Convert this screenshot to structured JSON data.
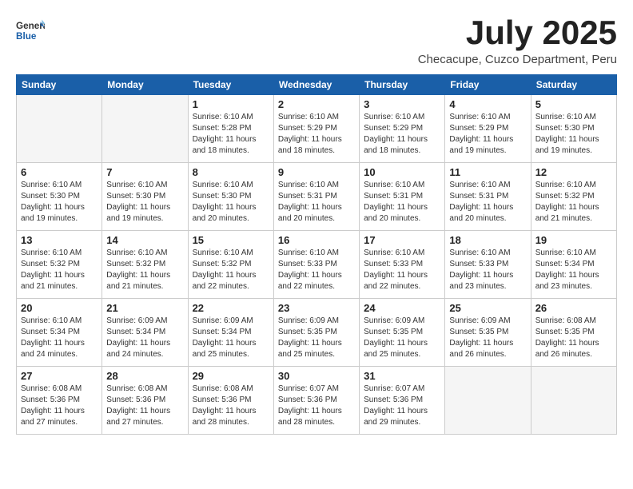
{
  "header": {
    "logo_general": "General",
    "logo_blue": "Blue",
    "month": "July 2025",
    "location": "Checacupe, Cuzco Department, Peru"
  },
  "weekdays": [
    "Sunday",
    "Monday",
    "Tuesday",
    "Wednesday",
    "Thursday",
    "Friday",
    "Saturday"
  ],
  "weeks": [
    [
      {
        "day": "",
        "sunrise": "",
        "sunset": "",
        "daylight": ""
      },
      {
        "day": "",
        "sunrise": "",
        "sunset": "",
        "daylight": ""
      },
      {
        "day": "1",
        "sunrise": "Sunrise: 6:10 AM",
        "sunset": "Sunset: 5:28 PM",
        "daylight": "Daylight: 11 hours and 18 minutes."
      },
      {
        "day": "2",
        "sunrise": "Sunrise: 6:10 AM",
        "sunset": "Sunset: 5:29 PM",
        "daylight": "Daylight: 11 hours and 18 minutes."
      },
      {
        "day": "3",
        "sunrise": "Sunrise: 6:10 AM",
        "sunset": "Sunset: 5:29 PM",
        "daylight": "Daylight: 11 hours and 18 minutes."
      },
      {
        "day": "4",
        "sunrise": "Sunrise: 6:10 AM",
        "sunset": "Sunset: 5:29 PM",
        "daylight": "Daylight: 11 hours and 19 minutes."
      },
      {
        "day": "5",
        "sunrise": "Sunrise: 6:10 AM",
        "sunset": "Sunset: 5:30 PM",
        "daylight": "Daylight: 11 hours and 19 minutes."
      }
    ],
    [
      {
        "day": "6",
        "sunrise": "Sunrise: 6:10 AM",
        "sunset": "Sunset: 5:30 PM",
        "daylight": "Daylight: 11 hours and 19 minutes."
      },
      {
        "day": "7",
        "sunrise": "Sunrise: 6:10 AM",
        "sunset": "Sunset: 5:30 PM",
        "daylight": "Daylight: 11 hours and 19 minutes."
      },
      {
        "day": "8",
        "sunrise": "Sunrise: 6:10 AM",
        "sunset": "Sunset: 5:30 PM",
        "daylight": "Daylight: 11 hours and 20 minutes."
      },
      {
        "day": "9",
        "sunrise": "Sunrise: 6:10 AM",
        "sunset": "Sunset: 5:31 PM",
        "daylight": "Daylight: 11 hours and 20 minutes."
      },
      {
        "day": "10",
        "sunrise": "Sunrise: 6:10 AM",
        "sunset": "Sunset: 5:31 PM",
        "daylight": "Daylight: 11 hours and 20 minutes."
      },
      {
        "day": "11",
        "sunrise": "Sunrise: 6:10 AM",
        "sunset": "Sunset: 5:31 PM",
        "daylight": "Daylight: 11 hours and 20 minutes."
      },
      {
        "day": "12",
        "sunrise": "Sunrise: 6:10 AM",
        "sunset": "Sunset: 5:32 PM",
        "daylight": "Daylight: 11 hours and 21 minutes."
      }
    ],
    [
      {
        "day": "13",
        "sunrise": "Sunrise: 6:10 AM",
        "sunset": "Sunset: 5:32 PM",
        "daylight": "Daylight: 11 hours and 21 minutes."
      },
      {
        "day": "14",
        "sunrise": "Sunrise: 6:10 AM",
        "sunset": "Sunset: 5:32 PM",
        "daylight": "Daylight: 11 hours and 21 minutes."
      },
      {
        "day": "15",
        "sunrise": "Sunrise: 6:10 AM",
        "sunset": "Sunset: 5:32 PM",
        "daylight": "Daylight: 11 hours and 22 minutes."
      },
      {
        "day": "16",
        "sunrise": "Sunrise: 6:10 AM",
        "sunset": "Sunset: 5:33 PM",
        "daylight": "Daylight: 11 hours and 22 minutes."
      },
      {
        "day": "17",
        "sunrise": "Sunrise: 6:10 AM",
        "sunset": "Sunset: 5:33 PM",
        "daylight": "Daylight: 11 hours and 22 minutes."
      },
      {
        "day": "18",
        "sunrise": "Sunrise: 6:10 AM",
        "sunset": "Sunset: 5:33 PM",
        "daylight": "Daylight: 11 hours and 23 minutes."
      },
      {
        "day": "19",
        "sunrise": "Sunrise: 6:10 AM",
        "sunset": "Sunset: 5:34 PM",
        "daylight": "Daylight: 11 hours and 23 minutes."
      }
    ],
    [
      {
        "day": "20",
        "sunrise": "Sunrise: 6:10 AM",
        "sunset": "Sunset: 5:34 PM",
        "daylight": "Daylight: 11 hours and 24 minutes."
      },
      {
        "day": "21",
        "sunrise": "Sunrise: 6:09 AM",
        "sunset": "Sunset: 5:34 PM",
        "daylight": "Daylight: 11 hours and 24 minutes."
      },
      {
        "day": "22",
        "sunrise": "Sunrise: 6:09 AM",
        "sunset": "Sunset: 5:34 PM",
        "daylight": "Daylight: 11 hours and 25 minutes."
      },
      {
        "day": "23",
        "sunrise": "Sunrise: 6:09 AM",
        "sunset": "Sunset: 5:35 PM",
        "daylight": "Daylight: 11 hours and 25 minutes."
      },
      {
        "day": "24",
        "sunrise": "Sunrise: 6:09 AM",
        "sunset": "Sunset: 5:35 PM",
        "daylight": "Daylight: 11 hours and 25 minutes."
      },
      {
        "day": "25",
        "sunrise": "Sunrise: 6:09 AM",
        "sunset": "Sunset: 5:35 PM",
        "daylight": "Daylight: 11 hours and 26 minutes."
      },
      {
        "day": "26",
        "sunrise": "Sunrise: 6:08 AM",
        "sunset": "Sunset: 5:35 PM",
        "daylight": "Daylight: 11 hours and 26 minutes."
      }
    ],
    [
      {
        "day": "27",
        "sunrise": "Sunrise: 6:08 AM",
        "sunset": "Sunset: 5:36 PM",
        "daylight": "Daylight: 11 hours and 27 minutes."
      },
      {
        "day": "28",
        "sunrise": "Sunrise: 6:08 AM",
        "sunset": "Sunset: 5:36 PM",
        "daylight": "Daylight: 11 hours and 27 minutes."
      },
      {
        "day": "29",
        "sunrise": "Sunrise: 6:08 AM",
        "sunset": "Sunset: 5:36 PM",
        "daylight": "Daylight: 11 hours and 28 minutes."
      },
      {
        "day": "30",
        "sunrise": "Sunrise: 6:07 AM",
        "sunset": "Sunset: 5:36 PM",
        "daylight": "Daylight: 11 hours and 28 minutes."
      },
      {
        "day": "31",
        "sunrise": "Sunrise: 6:07 AM",
        "sunset": "Sunset: 5:36 PM",
        "daylight": "Daylight: 11 hours and 29 minutes."
      },
      {
        "day": "",
        "sunrise": "",
        "sunset": "",
        "daylight": ""
      },
      {
        "day": "",
        "sunrise": "",
        "sunset": "",
        "daylight": ""
      }
    ]
  ]
}
